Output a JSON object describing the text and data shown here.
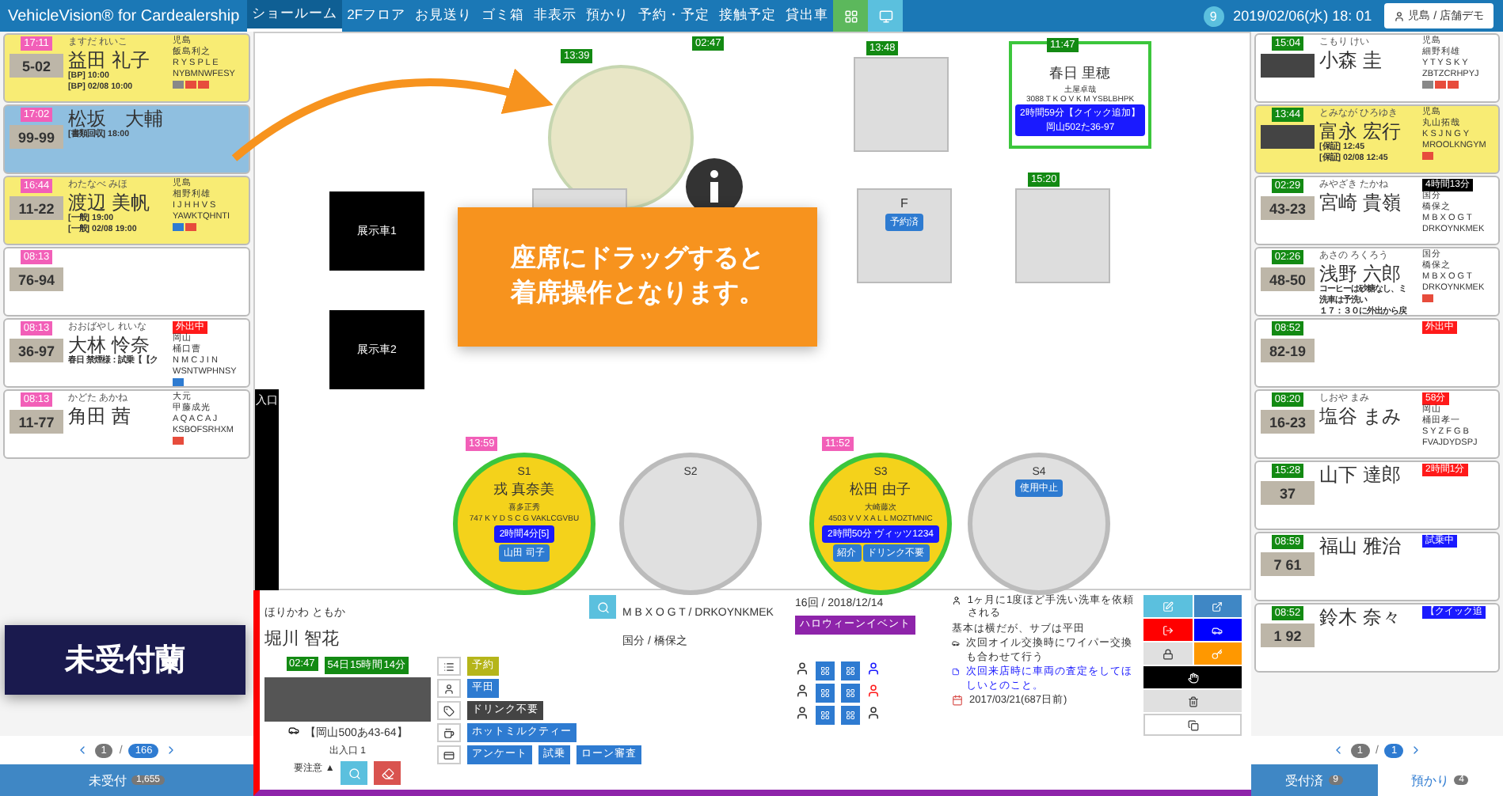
{
  "header": {
    "title": "VehicleVision® for Cardealership",
    "tabs": [
      {
        "label": "ショールーム",
        "selected": true
      },
      {
        "label": "2Fフロア",
        "selected": false
      },
      {
        "label": "お見送り",
        "selected": false
      },
      {
        "label": "ゴミ箱",
        "selected": false
      },
      {
        "label": "非表示",
        "selected": false
      },
      {
        "label": "預かり",
        "selected": false
      },
      {
        "label": "予約・予定",
        "selected": false
      },
      {
        "label": "接触予定",
        "selected": false
      },
      {
        "label": "貸出車",
        "selected": false
      }
    ],
    "badge": "9",
    "datetime": "2019/02/06(水) 18: 01",
    "user": "児島 / 店舗デモ"
  },
  "unreceived": {
    "cards": [
      {
        "time": "17:11",
        "kana": "ますだ れいこ",
        "name": "益田 礼子",
        "plate": "5-02",
        "notes": [
          "[BP] 10:00",
          "[BP] 02/08 10:00"
        ],
        "info": [
          "児島",
          "飯島利之",
          "R Y S P L E",
          "NYBMNWFESY"
        ],
        "color": "#f8ec74",
        "tags": [
          {
            "color": "#888888"
          },
          {
            "color": "#e74c3c"
          },
          {
            "color": "#e74c3c"
          }
        ]
      },
      {
        "time": "17:02",
        "name": "松坂　大輔",
        "plate": "99-99",
        "notes": [
          "[書類回収] 18:00"
        ],
        "color": "#8fbfe0"
      },
      {
        "time": "16:44",
        "kana": "わたなべ みほ",
        "name": "渡辺 美帆",
        "plate": "11-22",
        "notes": [
          "[一般] 19:00",
          "[一般] 02/08 19:00"
        ],
        "info": [
          "児島",
          "相野利雄",
          "I J H H V S",
          "YAWKTQHNTI"
        ],
        "color": "#f8ec74",
        "tags": [
          {
            "color": "#2e7bd1"
          },
          {
            "color": "#e74c3c"
          }
        ]
      },
      {
        "time": "08:13",
        "plate": "76-94",
        "color": "#ffffff"
      },
      {
        "time": "08:13",
        "kana": "おおばやし れいな",
        "name": "大林 怜奈",
        "plate": "36-97",
        "notes": [
          "春日 禁煙様：試乗【【ク"
        ],
        "status": {
          "label": "外出中",
          "color": "#ff1a1a"
        },
        "info": [
          "岡山",
          "桶口曹",
          "N M C J I N",
          "WSNTWPHNSY"
        ],
        "color": "#ffffff",
        "tags": [
          {
            "color": "#2e7bd1"
          }
        ]
      },
      {
        "time": "08:13",
        "kana": "かどた あかね",
        "name": "角田 茜",
        "plate": "11-77",
        "info": [
          "大元",
          "甲藤成光",
          "A Q A C A J",
          "KSBOFSRHXM"
        ],
        "color": "#ffffff",
        "tags": [
          {
            "color": "#e74c3c"
          }
        ]
      }
    ],
    "overlay_label": "未受付蘭",
    "page": "1",
    "separator": "/",
    "pages": "166",
    "button": "未受付",
    "count": "1,655"
  },
  "floor": {
    "top_spots": [
      {
        "kind": "ghost",
        "time": "13:39"
      },
      {
        "kind": "info",
        "time": "02:47"
      },
      {
        "kind": "square",
        "time": "13:48"
      },
      {
        "kind": "card",
        "time": "11:47",
        "name": "春日 里穂",
        "staff": "土屋卓哉",
        "code": "3088 T K O V K M YSBLBHPK",
        "tag": "2時間59分【クイック追加】岡山502た36-97"
      }
    ],
    "display_cars": [
      "展示車1",
      "展示車2"
    ],
    "squares": [
      {
        "kind": "square"
      },
      {
        "kind": "square",
        "label": "F",
        "status": "予約済"
      },
      {
        "kind": "square",
        "time": "15:20"
      }
    ],
    "entrance": "入口",
    "seats": [
      {
        "label": "S1",
        "occupied": true,
        "time": "13:59",
        "name": "戎 真奈美",
        "staff": "喜多正秀",
        "code": "747 K Y D S C G VAKLCGVBU",
        "duration": "2時間4分[5]",
        "tags": [
          "山田 司子"
        ]
      },
      {
        "label": "S2",
        "occupied": false
      },
      {
        "label": "S3",
        "occupied": true,
        "time": "11:52",
        "name": "松田 由子",
        "staff": "大崎藤次",
        "code": "4503 V V X A L L MOZTMNIC",
        "duration": "2時間50分 ヴィッツ1234",
        "tags": [
          "紹介",
          "ドリンク不要"
        ]
      },
      {
        "label": "S4",
        "occupied": false,
        "status": "使用中止"
      }
    ],
    "tooltip": [
      "座席にドラッグすると",
      "着席操作となります。"
    ]
  },
  "detail": {
    "kana": "ほりかわ ともか",
    "name": "堀川 智花",
    "codes": "M B X O G T / DRKOYNKMEK",
    "store": "国分 / 橋保之",
    "visits": "16回 / 2018/12/14",
    "event": "ハロウィーンイベント",
    "time": "02:47",
    "elapsed": "54日15時間14分",
    "plate": "【岡山500あ43-64】",
    "gate": "出入口 1",
    "caution": "要注意 ▲",
    "tag_rows": [
      [
        {
          "label": "予約",
          "color": "#b5b51a"
        }
      ],
      [
        {
          "label": "平田",
          "color": "#2e7bd1"
        }
      ],
      [
        {
          "label": "ドリンク不要",
          "color": "#444444"
        }
      ],
      [
        {
          "label": "ホットミルクティー",
          "color": "#2e7bd1"
        }
      ],
      [
        {
          "label": "アンケート",
          "color": "#2e7bd1"
        },
        {
          "label": "試乗",
          "color": "#2e7bd1"
        },
        {
          "label": "ローン審査",
          "color": "#2e7bd1"
        }
      ]
    ],
    "notes": [
      {
        "kind": "person",
        "text": "1ヶ月に1度ほど手洗い洗車を依頼される"
      },
      {
        "kind": "plain",
        "text": "基本は横だが、サブは平田"
      },
      {
        "kind": "car",
        "text": "次回オイル交換時にワイパー交換も合わせて行う"
      },
      {
        "kind": "memo",
        "text": "次回来店時に車両の査定をしてほしいとのこと。"
      },
      {
        "kind": "date",
        "text": "2017/03/21(687日前)"
      }
    ]
  },
  "received": {
    "cards": [
      {
        "time": "15:04",
        "kana": "こもり けい",
        "name": "小森 圭",
        "info": [
          "児島",
          "細野利雄",
          "Y T Y S K Y",
          "ZBTZCRHPYJ"
        ],
        "color": "#ffffff",
        "tags": [
          {
            "color": "#888888"
          },
          {
            "color": "#e74c3c"
          },
          {
            "color": "#e74c3c"
          }
        ]
      },
      {
        "time": "13:44",
        "kana": "とみなが ひろゆき",
        "name": "富永 宏行",
        "notes": [
          "[保証] 12:45",
          "[保証] 02/08 12:45"
        ],
        "info": [
          "児島",
          "丸山拓哉",
          "K S J N G Y",
          "MROOLKNGYM"
        ],
        "color": "#f8ec74",
        "tags": [
          {
            "color": "#e74c3c"
          }
        ]
      },
      {
        "time": "02:29",
        "kana": "みやざき たかね",
        "name": "宮崎 貴嶺",
        "plate": "43-23",
        "status": {
          "label": "4時間13分",
          "color": "#000000"
        },
        "info": [
          "国分",
          "橋保之",
          "M B X O G T",
          "DRKOYNKMEK"
        ],
        "color": "#ffffff"
      },
      {
        "time": "02:26",
        "kana": "あさの ろくろう",
        "name": "浅野 六郎",
        "plate": "48-50",
        "notes": [
          "コーヒーは砂糖なし、ミ",
          "洗車は予洗い",
          "１７：３０に外出から戻"
        ],
        "info": [
          "国分",
          "橋保之",
          "M B X O G T",
          "DRKOYNKMEK"
        ],
        "color": "#ffffff",
        "tags": [
          {
            "color": "#e74c3c"
          }
        ]
      },
      {
        "time": "08:52",
        "plate": "82-19",
        "status": {
          "label": "外出中",
          "color": "#ff1a1a"
        },
        "color": "#ffffff"
      },
      {
        "time": "08:20",
        "kana": "しおや まみ",
        "name": "塩谷 まみ",
        "plate": "16-23",
        "status": {
          "label": "58分",
          "color": "#ff1a1a"
        },
        "info": [
          "岡山",
          "桶田孝一",
          "S Y Z F G B",
          "FVAJDYDSPJ"
        ],
        "color": "#ffffff"
      },
      {
        "time": "15:28",
        "name": "山下 達郎",
        "plate": "37",
        "status": {
          "label": "2時間1分",
          "color": "#ff1a1a"
        },
        "color": "#ffffff"
      },
      {
        "time": "08:59",
        "name": "福山 雅治",
        "plate": "7 61",
        "status": {
          "label": "試乗中",
          "color": "#1a1aff"
        },
        "color": "#ffffff"
      },
      {
        "time": "08:52",
        "name": "鈴木 奈々",
        "plate": "1 92",
        "status": {
          "label": "【クイック追",
          "color": "#1a1aff"
        },
        "color": "#ffffff"
      }
    ],
    "page": "1",
    "separator": "/",
    "pages": "1",
    "button": "受付済",
    "count": "9",
    "button2": "預かり",
    "count2": "4"
  }
}
